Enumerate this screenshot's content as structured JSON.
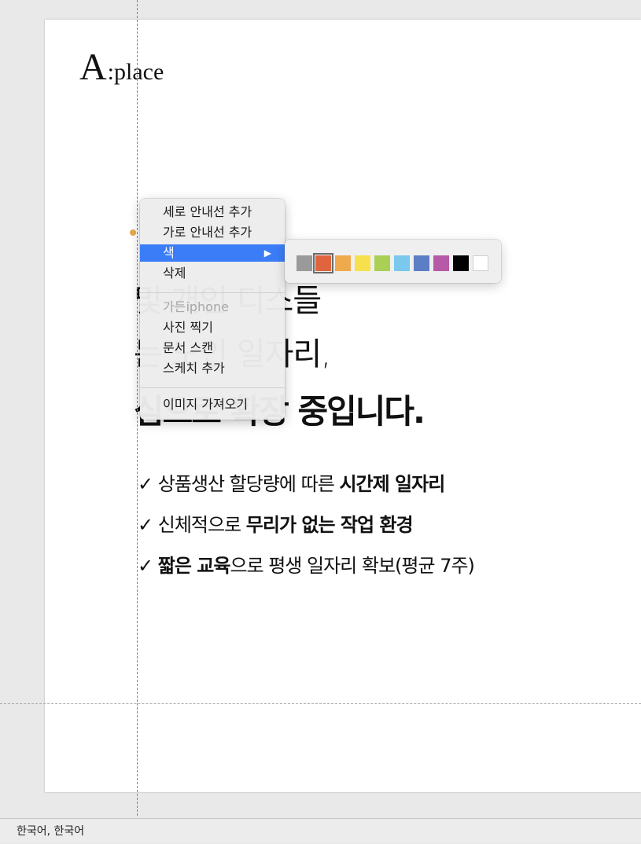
{
  "slide": {
    "logo": {
      "big": "A",
      "rest": ":place"
    },
    "headline": {
      "line1": "및 개인 디스들",
      "line2": "는 노인 일자리,",
      "line3": "심으로 확장 중입니다."
    },
    "bullets": [
      {
        "check": "✓",
        "pre": " 상품생산 할당량에 따른 ",
        "bold": "시간제 일자리",
        "post": ""
      },
      {
        "check": "✓",
        "pre": " 신체적으로 ",
        "bold": "무리가 없는 작업 환경",
        "post": ""
      },
      {
        "check": "✓",
        "pre": " ",
        "bold": "짧은 교육",
        "post": "으로 평생 일자리 확보(평균 7주)"
      }
    ]
  },
  "context_menu": {
    "items": {
      "add_vertical_guide": "세로 안내선 추가",
      "add_horizontal_guide": "가로 안내선 추가",
      "color": "색",
      "color_arrow": "▶",
      "delete": "삭제",
      "device_header": "가든iphone",
      "take_photo": "사진 찍기",
      "scan_documents": "문서 스캔",
      "add_sketch": "스케치 추가",
      "import_image": "이미지 가져오기"
    }
  },
  "color_palette": {
    "swatches": [
      {
        "name": "gray",
        "color": "#9a9a9a"
      },
      {
        "name": "red",
        "color": "#e0653f"
      },
      {
        "name": "orange",
        "color": "#efaa4e"
      },
      {
        "name": "yellow",
        "color": "#f7e04e"
      },
      {
        "name": "green",
        "color": "#a9cf54"
      },
      {
        "name": "light-blue",
        "color": "#7ac8ec"
      },
      {
        "name": "blue",
        "color": "#5c7ec4"
      },
      {
        "name": "purple",
        "color": "#b65aa8"
      },
      {
        "name": "black",
        "color": "#000000"
      },
      {
        "name": "white",
        "color": "#ffffff"
      }
    ],
    "selected": "red"
  },
  "statusbar": {
    "language": "한국어, 한국어"
  },
  "colors": {
    "guide": "#d9643f",
    "menu_highlight": "#3b7df6"
  }
}
